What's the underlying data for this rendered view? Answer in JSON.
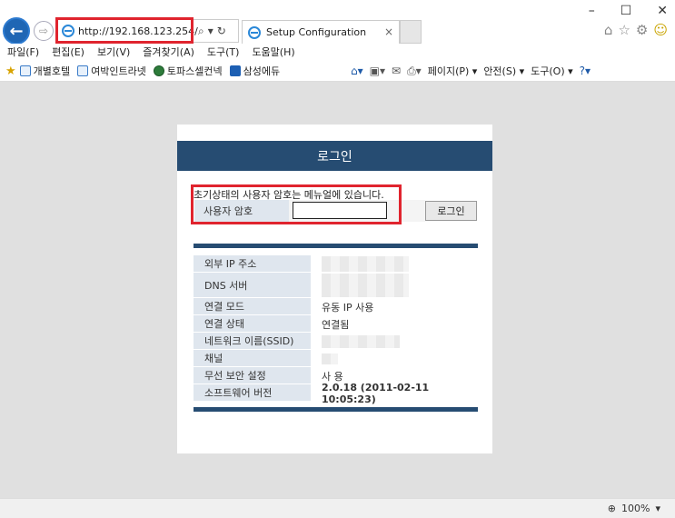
{
  "browser": {
    "url": "http://192.168.123.254/",
    "tab_title": "Setup Configuration",
    "tab_close": "×",
    "window_controls": [
      "–",
      "☐",
      "✕"
    ]
  },
  "menu": [
    "파일(F)",
    "편집(E)",
    "보기(V)",
    "즐겨찾기(A)",
    "도구(T)",
    "도움말(H)"
  ],
  "favorites": [
    "개별호텔",
    "여박인트라넷",
    "토파스셀컨넥",
    "삼성에듀"
  ],
  "commands": {
    "page": "페이지(P) ▾",
    "safety": "안전(S) ▾",
    "tools": "도구(O) ▾"
  },
  "login": {
    "header": "로그인",
    "notice": "초기상태의 사용자 암호는 메뉴얼에 있습니다.",
    "password_label": "사용자 암호",
    "password_value": "",
    "button": "로그인"
  },
  "info_rows": [
    {
      "label": "외부 IP 주소",
      "value": ""
    },
    {
      "label": "DNS 서버",
      "value": ""
    },
    {
      "label": "연결 모드",
      "value": "유동 IP 사용"
    },
    {
      "label": "연결 상태",
      "value": "연결됨"
    },
    {
      "label": "네트워크 이름(SSID)",
      "value": ""
    },
    {
      "label": "채널",
      "value": ""
    },
    {
      "label": "무선 보안 설정",
      "value": "사 용"
    },
    {
      "label": "소프트웨어 버전",
      "value": "2.0.18 (2011-02-11 10:05:23)"
    }
  ],
  "status": {
    "zoom": "100%"
  },
  "colors": {
    "header": "#264c72",
    "highlight": "#e0242e"
  }
}
